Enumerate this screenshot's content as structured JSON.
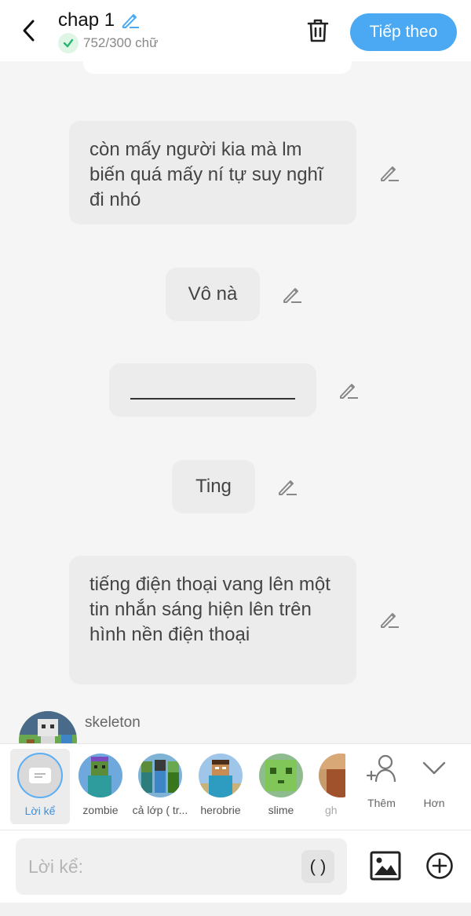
{
  "header": {
    "title": "chap 1",
    "word_count": "752/300 chữ",
    "next_label": "Tiếp theo"
  },
  "messages": [
    {
      "text": "còn mấy người kia mà lm biến quá mấy ní tự suy nghĩ đi nhó"
    },
    {
      "text": "Vô nà"
    },
    {
      "text": ""
    },
    {
      "text": "Ting"
    },
    {
      "text": "tiếng điện thoại vang lên một tin nhắn sáng hiện lên trên hình nền điện thoại"
    }
  ],
  "speaker": {
    "name": "skeleton"
  },
  "characters": [
    {
      "label": "Lời kể",
      "selected": true
    },
    {
      "label": "zombie"
    },
    {
      "label": "cả lớp ( tr..."
    },
    {
      "label": "herobrie"
    },
    {
      "label": "slime"
    },
    {
      "label": "gh"
    }
  ],
  "actions": {
    "add_label": "Thêm",
    "more_label": "Hơn"
  },
  "input": {
    "placeholder": "Lời kể:",
    "paren_label": "( )"
  },
  "colors": {
    "accent": "#4aa9f2",
    "bubble": "#ececec",
    "background": "#f5f5f5",
    "check": "#2bb673"
  }
}
